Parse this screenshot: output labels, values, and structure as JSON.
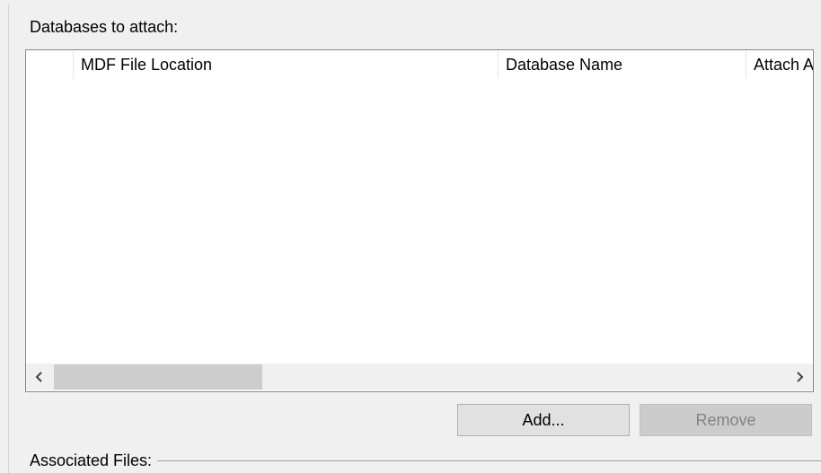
{
  "section": {
    "databases_label": "Databases to attach:"
  },
  "grid": {
    "columns": [
      {
        "label": ""
      },
      {
        "label": "MDF File Location"
      },
      {
        "label": "Database Name"
      },
      {
        "label": "Attach As"
      }
    ],
    "rows": []
  },
  "buttons": {
    "add_label": "Add...",
    "remove_label": "Remove"
  },
  "associated": {
    "label": "Associated Files:"
  }
}
